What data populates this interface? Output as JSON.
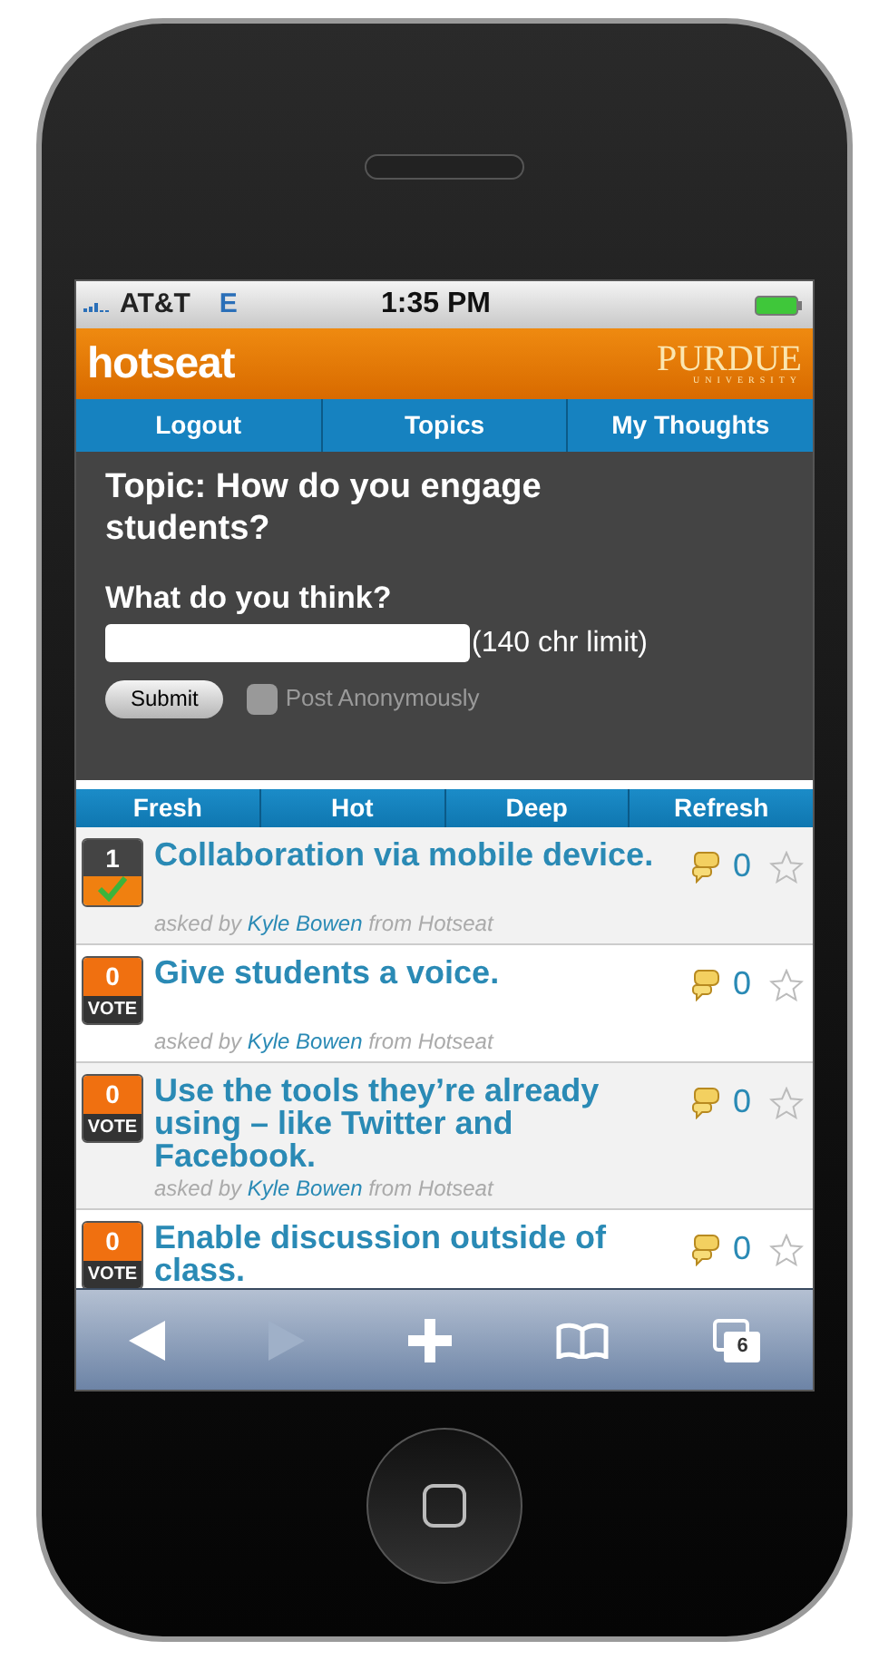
{
  "status_bar": {
    "carrier": "AT&T",
    "network": "E",
    "time": "1:35 PM"
  },
  "header": {
    "logo": "hotseat",
    "university": "PURDUE",
    "university_sub": "UNIVERSITY"
  },
  "nav": [
    {
      "label": "Logout"
    },
    {
      "label": "Topics"
    },
    {
      "label": "My Thoughts"
    }
  ],
  "topic": {
    "title": "Topic: How do you engage students?",
    "prompt": "What do you think?",
    "limit": "(140 chr limit)",
    "submit": "Submit",
    "anonymous": {
      "label": "Post Anonymously",
      "checked": false
    }
  },
  "sort_tabs": [
    {
      "label": "Fresh"
    },
    {
      "label": "Hot"
    },
    {
      "label": "Deep"
    },
    {
      "label": "Refresh"
    }
  ],
  "questions": [
    {
      "kind": "voted",
      "votes": "1",
      "title": "Collaboration via mobile device.",
      "asked": "asked by",
      "author": "Kyle Bowen",
      "source": "from Hotseat",
      "comments": "0",
      "starred": false
    },
    {
      "kind": "vote",
      "votes": "0",
      "vote_label": "VOTE",
      "title": "Give students a voice.",
      "asked": "asked by",
      "author": "Kyle Bowen",
      "source": "from Hotseat",
      "comments": "0",
      "starred": false
    },
    {
      "kind": "vote",
      "votes": "0",
      "vote_label": "VOTE",
      "title": "Use the tools they’re already using – like Twitter and Facebook.",
      "asked": "asked by",
      "author": "Kyle Bowen",
      "source": "from Hotseat",
      "comments": "0",
      "starred": false
    },
    {
      "kind": "vote",
      "votes": "0",
      "vote_label": "VOTE",
      "title": "Enable discussion outside of class.",
      "comments": "0",
      "starred": false
    }
  ],
  "toolbar": {
    "tab_count": "6"
  }
}
